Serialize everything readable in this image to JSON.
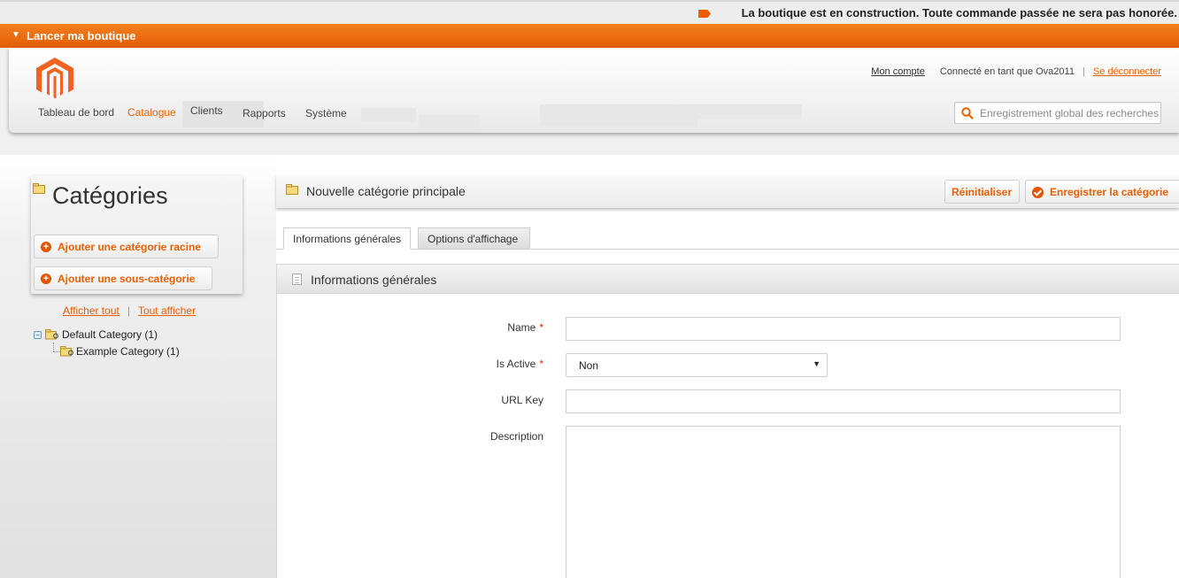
{
  "notice": {
    "text": "La boutique est en construction. Toute commande passée ne sera pas honorée."
  },
  "launch_bar": {
    "label": "Lancer ma boutique"
  },
  "header": {
    "account_link": "Mon compte",
    "connected_as": "Connecté en tant que Ova2011",
    "logout_link": "Se déconnecter",
    "search_placeholder": "Enregistrement global des recherches",
    "nav": [
      {
        "label": "Tableau de bord"
      },
      {
        "label": "Catalogue"
      },
      {
        "label": "Clients"
      },
      {
        "label": "Rapports"
      },
      {
        "label": "Système"
      }
    ]
  },
  "sidebar": {
    "title": "Catégories",
    "add_root_label": "Ajouter une catégorie racine",
    "add_sub_label": "Ajouter une sous-catégorie",
    "collapse_all": "Afficher tout",
    "expand_all": "Tout afficher",
    "tree": [
      {
        "label": "Default Category (1)"
      },
      {
        "label": "Example Category (1)"
      }
    ]
  },
  "content": {
    "title": "Nouvelle catégorie principale",
    "reset_label": "Réinitialiser",
    "save_label": "Enregistrer la catégorie",
    "tabs": [
      {
        "label": "Informations générales"
      },
      {
        "label": "Options d'affichage"
      }
    ],
    "section_title": "Informations générales",
    "form": {
      "name_label": "Name",
      "name_value": "",
      "is_active_label": "Is Active",
      "is_active_value": "Non",
      "url_key_label": "URL Key",
      "url_key_value": "",
      "description_label": "Description",
      "description_value": "",
      "required_mark": "*"
    }
  },
  "colors": {
    "accent": "#eb5e00",
    "launch_bar": "#f07a1a"
  }
}
